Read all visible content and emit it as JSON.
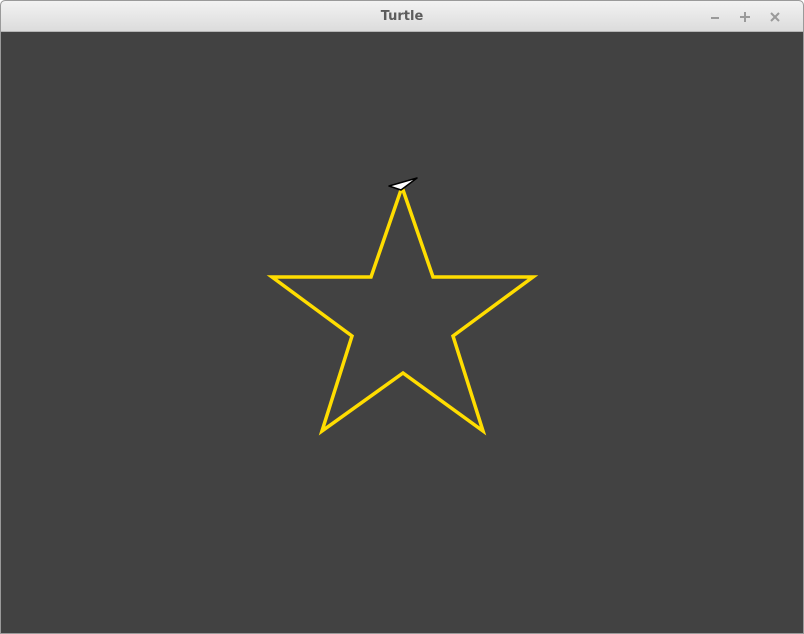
{
  "window": {
    "title": "Turtle",
    "controls": [
      "minimize-icon",
      "maximize-icon",
      "close-icon"
    ]
  },
  "canvas": {
    "background_color": "#424242",
    "drawing": {
      "shape": "five-pointed star",
      "pen_color": "#ffdd00"
    },
    "turtle": {
      "icon": "turtle-arrow-icon",
      "fill_color": "#ffffff",
      "outline_color": "#000000"
    }
  }
}
